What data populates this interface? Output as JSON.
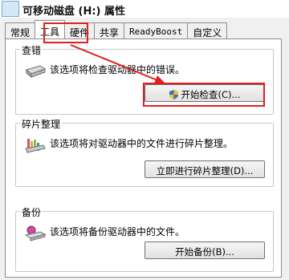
{
  "title": {
    "text": "可移动磁盘 (H:) 属性"
  },
  "tabs": [
    "常规",
    "工具",
    "硬件",
    "共享",
    "ReadyBoost",
    "自定义"
  ],
  "active_tab": "工具",
  "groups": {
    "check": {
      "title": "查错",
      "description": "该选项将检查驱动器中的错误。",
      "button": "开始检查(C)..."
    },
    "defrag": {
      "title": "碎片整理",
      "description": "该选项将对驱动器中的文件进行碎片整理。",
      "button": "立即进行碎片整理(D)..."
    },
    "backup": {
      "title": "备份",
      "description": "该选项将备份驱动器中的文件。",
      "button": "开始备份(B)..."
    }
  },
  "colors": {
    "annotation": "#e02020",
    "window_bg": "#f0f0f0"
  },
  "icons": [
    "drive-icon",
    "shield-icon",
    "defrag-icon",
    "backup-icon",
    "arrow-annotation-icon"
  ]
}
